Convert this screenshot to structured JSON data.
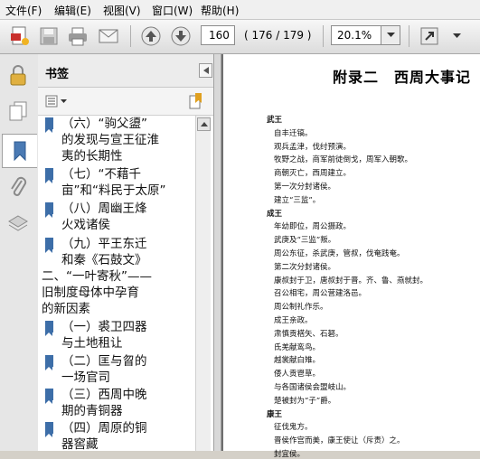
{
  "menu": [
    "文件(F)",
    "编辑(E)",
    "视图(V)",
    "窗口(W)",
    "帮助(H)"
  ],
  "toolbar": {
    "page_number": "160",
    "page_count": "( 176 / 179 )",
    "zoom": "20.1%"
  },
  "panel": {
    "title": "书签"
  },
  "bookmarks": [
    {
      "lines": [
        "（六）“驹父盨”",
        "的发现与宣王征淮",
        "夷的长期性"
      ]
    },
    {
      "lines": [
        "（七）“不藉千",
        "亩”和“料民于太原”"
      ]
    },
    {
      "lines": [
        "（八）周幽王烽",
        "火戏诸侯"
      ]
    },
    {
      "lines": [
        "（九）平王东迁",
        "和秦《石鼓文》"
      ]
    },
    {
      "lines": [
        "二、“一叶寄秋”——",
        "旧制度母体中孕育",
        "的新因素"
      ]
    },
    {
      "lines": [
        "（一）裘卫四器",
        "与土地租让"
      ]
    },
    {
      "lines": [
        "（二）匡与曶的",
        "一场官司"
      ]
    },
    {
      "lines": [
        "（三）西周中晚",
        "期的青铜器"
      ]
    },
    {
      "lines": [
        "（四）周原的铜",
        "器窖藏"
      ]
    }
  ],
  "document": {
    "title": "附录二　西周大事记",
    "lines": [
      "武王",
      "自丰迁镐。",
      "观兵孟津，伐纣预演。",
      "牧野之战，商军前徒倒戈，周军入朝歌。",
      "商朝灭亡，西周建立。",
      "第一次分封诸侯。",
      "建立“三监”。",
      "成王",
      "年幼即位，周公摄政。",
      "武庚及“三监”叛。",
      "周公东征，杀武庚，管叔，伐奄践奄。",
      "第二次分封诸侯。",
      "康叔封于卫，唐叔封于晋。齐、鲁、燕就封。",
      "召公相宅，周公营建洛邑。",
      "周公制礼作乐。",
      "成王亲政。",
      "肃慎贡楛矢、石砮。",
      "氐羌献鸾鸟。",
      "越裳献白雉。",
      "倭人贡鬯草。",
      "与各国诸侯会盟岐山。",
      "楚被封为“子”爵。",
      "康王",
      "征伐鬼方。",
      "晋侯作宫而美，康王使让（斥责）之。",
      "封宜侯。"
    ]
  }
}
